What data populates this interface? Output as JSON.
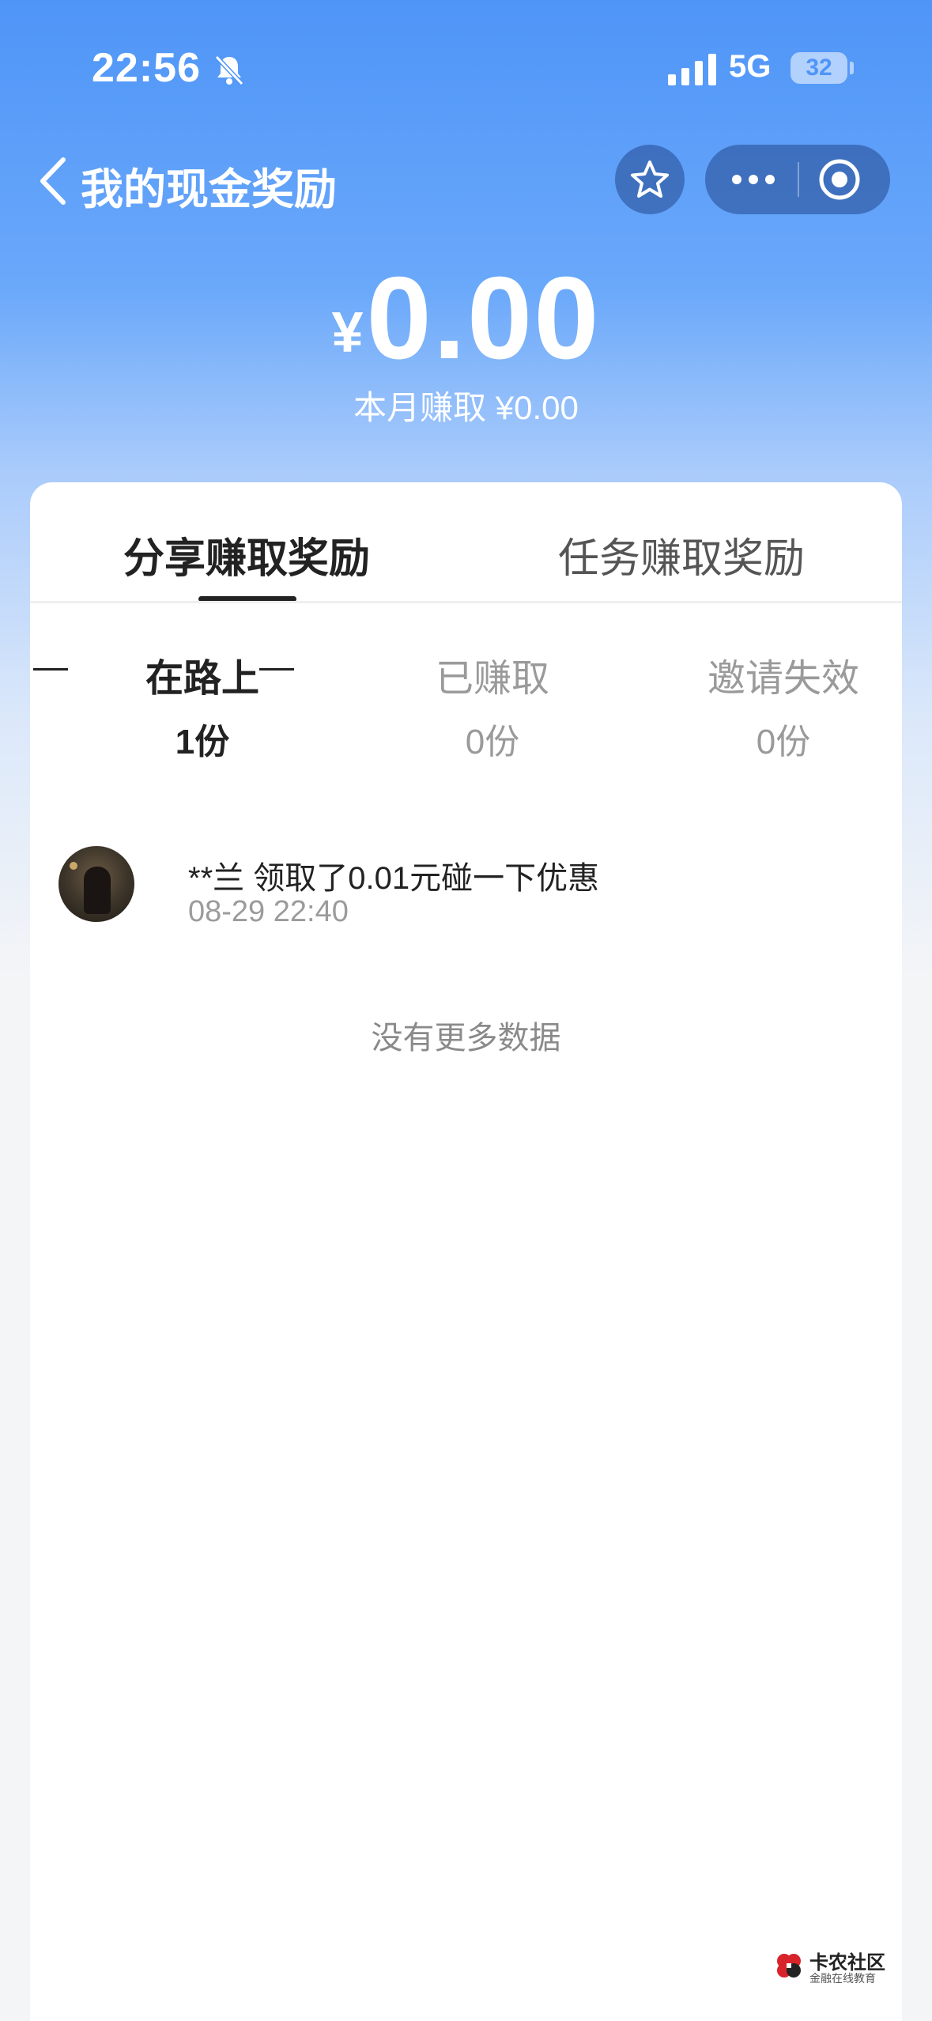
{
  "status_bar": {
    "time": "22:56",
    "network": "5G",
    "battery": "32",
    "icons": [
      "bell-muted-icon",
      "signal-icon",
      "battery-icon"
    ]
  },
  "nav": {
    "title": "我的现金奖励",
    "icons": [
      "back-chevron-icon",
      "star-icon",
      "more-dots-icon",
      "close-target-icon"
    ]
  },
  "summary": {
    "currency": "¥",
    "amount": "0.00",
    "month_label": "本月赚取 ¥0.00"
  },
  "tabs": [
    {
      "label": "分享赚取奖励",
      "active": true
    },
    {
      "label": "任务赚取奖励",
      "active": false
    }
  ],
  "subtabs": [
    {
      "label": "在路上",
      "count": "1份",
      "active": true
    },
    {
      "label": "已赚取",
      "count": "0份",
      "active": false
    },
    {
      "label": "邀请失效",
      "count": "0份",
      "active": false
    }
  ],
  "records": [
    {
      "text": "**兰 领取了0.01元碰一下优惠",
      "time": "08-29 22:40"
    }
  ],
  "empty_hint": "没有更多数据",
  "watermark": {
    "title": "卡农社区",
    "subtitle": "金融在线教育"
  },
  "colors": {
    "header_blue": "#4f95f8",
    "capsule": "#2e5a9e",
    "text_dark": "#222222",
    "text_muted": "#9a9a9a"
  }
}
